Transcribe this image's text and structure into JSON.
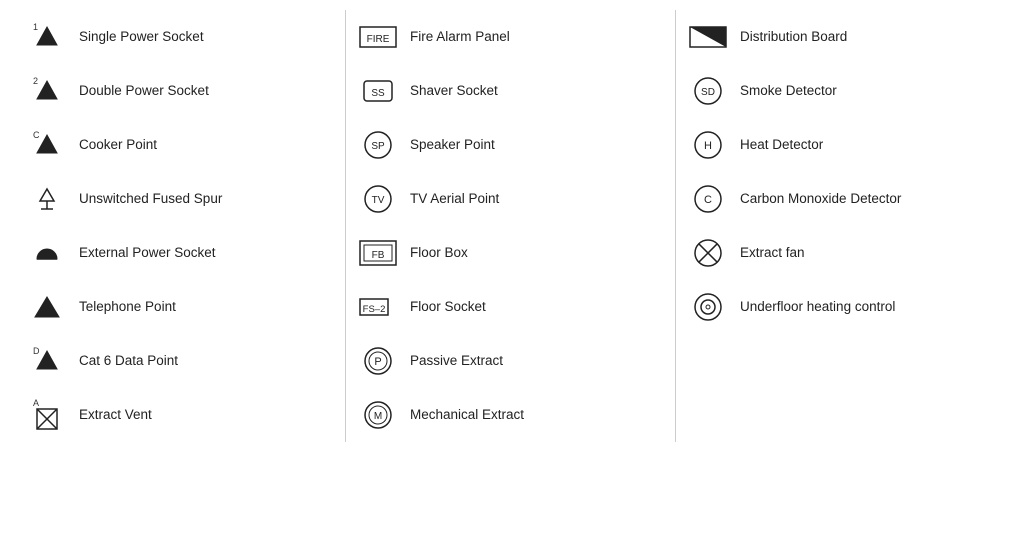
{
  "legend": {
    "column1": [
      {
        "id": "single-power-socket",
        "label": "Single Power Socket",
        "symbol": "single-power"
      },
      {
        "id": "double-power-socket",
        "label": "Double Power Socket",
        "symbol": "double-power"
      },
      {
        "id": "cooker-point",
        "label": "Cooker Point",
        "symbol": "cooker"
      },
      {
        "id": "unswitched-fused-spur",
        "label": "Unswitched Fused Spur",
        "symbol": "fused-spur"
      },
      {
        "id": "external-power-socket",
        "label": "External Power Socket",
        "symbol": "external-power"
      },
      {
        "id": "telephone-point",
        "label": "Telephone Point",
        "symbol": "telephone"
      },
      {
        "id": "cat6-data-point",
        "label": "Cat 6 Data Point",
        "symbol": "cat6"
      },
      {
        "id": "extract-vent",
        "label": "Extract Vent",
        "symbol": "extract-vent"
      }
    ],
    "column2": [
      {
        "id": "fire-alarm-panel",
        "label": "Fire Alarm Panel",
        "symbol": "fire-alarm"
      },
      {
        "id": "shaver-socket",
        "label": "Shaver Socket",
        "symbol": "shaver"
      },
      {
        "id": "speaker-point",
        "label": "Speaker Point",
        "symbol": "speaker"
      },
      {
        "id": "tv-aerial-point",
        "label": "TV Aerial Point",
        "symbol": "tv-aerial"
      },
      {
        "id": "floor-box",
        "label": "Floor Box",
        "symbol": "floor-box"
      },
      {
        "id": "floor-socket",
        "label": "Floor Socket",
        "symbol": "floor-socket"
      },
      {
        "id": "passive-extract",
        "label": "Passive Extract",
        "symbol": "passive-extract"
      },
      {
        "id": "mechanical-extract",
        "label": "Mechanical Extract",
        "symbol": "mechanical-extract"
      }
    ],
    "column3": [
      {
        "id": "distribution-board",
        "label": "Distribution Board",
        "symbol": "distribution-board"
      },
      {
        "id": "smoke-detector",
        "label": "Smoke Detector",
        "symbol": "smoke-detector"
      },
      {
        "id": "heat-detector",
        "label": "Heat Detector",
        "symbol": "heat-detector"
      },
      {
        "id": "carbon-monoxide-detector",
        "label": "Carbon Monoxide Detector",
        "symbol": "co-detector"
      },
      {
        "id": "extract-fan",
        "label": "Extract fan",
        "symbol": "extract-fan"
      },
      {
        "id": "underfloor-heating",
        "label": "Underfloor heating control",
        "symbol": "underfloor"
      }
    ]
  }
}
